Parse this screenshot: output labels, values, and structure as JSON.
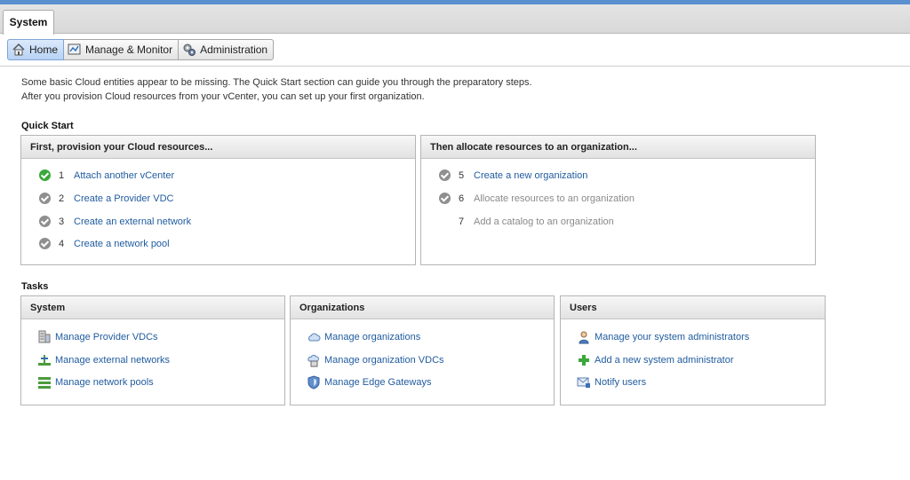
{
  "tabs": {
    "system": "System"
  },
  "toolbar": {
    "home": "Home",
    "manage_monitor": "Manage & Monitor",
    "administration": "Administration"
  },
  "intro": {
    "line1": "Some basic Cloud entities appear to be missing. The Quick Start section can guide you through the preparatory steps.",
    "line2": "After you provision Cloud resources from your vCenter, you can set up your first organization."
  },
  "quick_start": {
    "title": "Quick Start",
    "provision": {
      "title": "First, provision your Cloud resources...",
      "steps": [
        {
          "num": "1",
          "label": "Attach another vCenter",
          "status": "done"
        },
        {
          "num": "2",
          "label": "Create a Provider VDC",
          "status": "pending"
        },
        {
          "num": "3",
          "label": "Create an external network",
          "status": "pending"
        },
        {
          "num": "4",
          "label": "Create a network pool",
          "status": "pending"
        }
      ]
    },
    "allocate": {
      "title": "Then allocate resources to an organization...",
      "steps": [
        {
          "num": "5",
          "label": "Create a new organization",
          "status": "pending"
        },
        {
          "num": "6",
          "label": "Allocate resources to an organization",
          "status": "disabled"
        },
        {
          "num": "7",
          "label": "Add a catalog to an organization",
          "status": "disabled-nocheck"
        }
      ]
    }
  },
  "tasks": {
    "title": "Tasks",
    "system": {
      "title": "System",
      "items": [
        {
          "label": "Manage Provider VDCs",
          "icon": "provider-vdc-icon"
        },
        {
          "label": "Manage external networks",
          "icon": "external-network-icon"
        },
        {
          "label": "Manage network pools",
          "icon": "network-pool-icon"
        }
      ]
    },
    "organizations": {
      "title": "Organizations",
      "items": [
        {
          "label": "Manage organizations",
          "icon": "cloud-icon"
        },
        {
          "label": "Manage organization VDCs",
          "icon": "org-vdc-icon"
        },
        {
          "label": "Manage Edge Gateways",
          "icon": "edge-gateway-icon"
        }
      ]
    },
    "users": {
      "title": "Users",
      "items": [
        {
          "label": "Manage your system administrators",
          "icon": "user-icon"
        },
        {
          "label": "Add a new system administrator",
          "icon": "plus-icon"
        },
        {
          "label": "Notify users",
          "icon": "notify-icon"
        }
      ]
    }
  },
  "colors": {
    "link": "#1f5b9e",
    "done": "#3aa83a",
    "pending": "#8f8f8f",
    "accent": "#5a8fd0"
  }
}
